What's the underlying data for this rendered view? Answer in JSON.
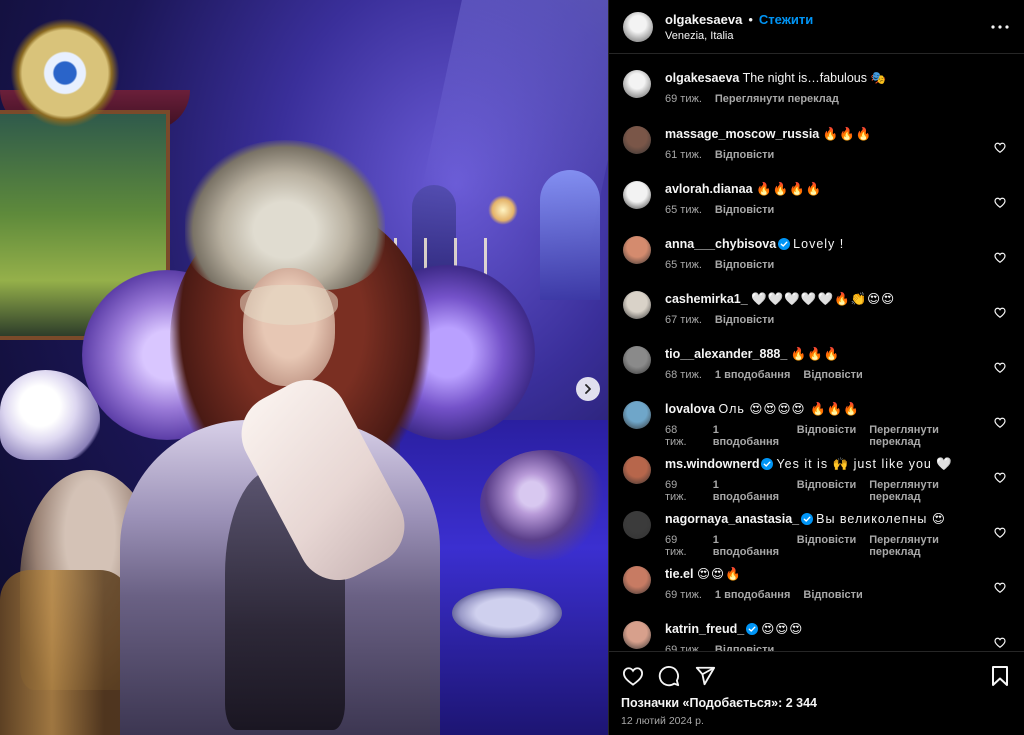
{
  "post": {
    "username": "olgakesaeva",
    "separator": "•",
    "follow_label": "Стежити",
    "location": "Venezia, Italia"
  },
  "caption": {
    "username": "olgakesaeva",
    "text": "The night is…fabulous 🎭",
    "time": "69 тиж.",
    "translate": "Переглянути переклад"
  },
  "comments": [
    {
      "username": "massage_moscow_russia",
      "verified": false,
      "text": "🔥🔥🔥",
      "time": "61 тиж.",
      "likes": "",
      "reply": "Відповісти",
      "translate": "",
      "avatar_color": "#7a5648"
    },
    {
      "username": "avlorah.dianaa",
      "verified": false,
      "text": "🔥🔥🔥🔥",
      "time": "65 тиж.",
      "likes": "",
      "reply": "Відповісти",
      "translate": "",
      "avatar_color": "#f2f2f2"
    },
    {
      "username": "anna___chybisova",
      "verified": true,
      "text": "Lovely !",
      "time": "65 тиж.",
      "likes": "",
      "reply": "Відповісти",
      "translate": "",
      "avatar_color": "#d48b6e"
    },
    {
      "username": "cashemirka1_",
      "verified": false,
      "text": "🤍🤍🤍🤍🤍🔥👏😍😍",
      "time": "67 тиж.",
      "likes": "",
      "reply": "Відповісти",
      "translate": "",
      "avatar_color": "#d9d2c8"
    },
    {
      "username": "tio__alexander_888_",
      "verified": false,
      "text": "🔥🔥🔥",
      "time": "68 тиж.",
      "likes": "1 вподобання",
      "reply": "Відповісти",
      "translate": "",
      "avatar_color": "#8a8a8a"
    },
    {
      "username": "lovalova",
      "verified": false,
      "text": "Оль 😍😍😍😍 🔥🔥🔥",
      "time": "68 тиж.",
      "likes": "1 вподобання",
      "reply": "Відповісти",
      "translate": "Переглянути переклад",
      "avatar_color": "#6fa6c9"
    },
    {
      "username": "ms.windownerd",
      "verified": true,
      "text": "Yes it is 🙌 just like you 🤍",
      "time": "69 тиж.",
      "likes": "1 вподобання",
      "reply": "Відповісти",
      "translate": "Переглянути переклад",
      "avatar_color": "#b7664b"
    },
    {
      "username": "nagornaya_anastasia_",
      "verified": true,
      "text": "Вы великолепны 😍",
      "time": "69 тиж.",
      "likes": "1 вподобання",
      "reply": "Відповісти",
      "translate": "Переглянути переклад",
      "avatar_color": "#3b3b3b"
    },
    {
      "username": "tie.el",
      "verified": false,
      "text": "😍😍🔥",
      "time": "69 тиж.",
      "likes": "1 вподобання",
      "reply": "Відповісти",
      "translate": "",
      "avatar_color": "#c77b63"
    },
    {
      "username": "katrin_freud_",
      "verified": true,
      "text": "😍😍😍",
      "time": "69 тиж.",
      "likes": "",
      "reply": "Відповісти",
      "translate": "",
      "avatar_color": "#d7a08c"
    }
  ],
  "footer": {
    "likes_label": "Позначки «Подобається»: 2 344",
    "date": "12 лютий 2024 р."
  },
  "icons": {
    "like": "heart-icon",
    "comment": "comment-icon",
    "share": "share-icon",
    "save": "bookmark-icon",
    "more": "more-icon",
    "next": "chevron-right-icon"
  },
  "colors": {
    "accent": "#0095f6",
    "muted": "#a8a8a8",
    "verified": "#0095f6",
    "background": "#000000"
  }
}
